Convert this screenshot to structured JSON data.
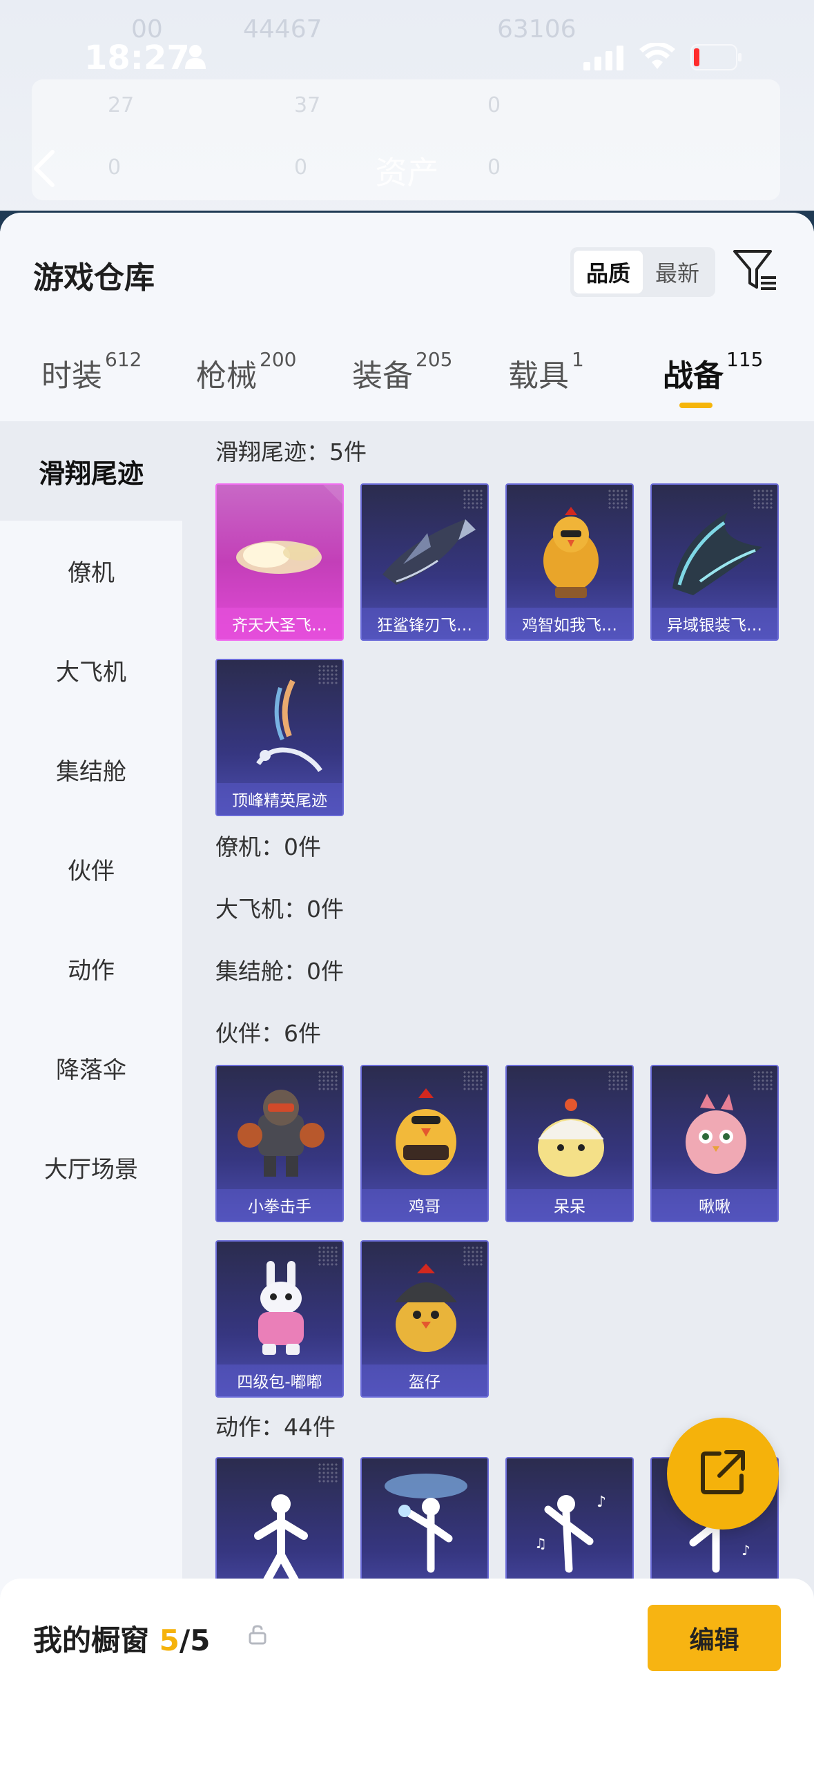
{
  "status_bar": {
    "time": "18:27"
  },
  "nav": {
    "title": "资产"
  },
  "background_header": {
    "ghost_texts": [
      "00",
      "44467",
      "63106",
      "27",
      "37",
      "0",
      "0",
      "0",
      "0"
    ]
  },
  "warehouse": {
    "title": "游戏仓库",
    "sort_options": [
      "品质",
      "最新"
    ],
    "active_sort": "品质"
  },
  "tabs": [
    {
      "label": "时装",
      "count": "612"
    },
    {
      "label": "枪械",
      "count": "200"
    },
    {
      "label": "装备",
      "count": "205"
    },
    {
      "label": "载具",
      "count": "1"
    },
    {
      "label": "战备",
      "count": "115"
    }
  ],
  "sidebar": {
    "items": [
      "滑翔尾迹",
      "僚机",
      "大飞机",
      "集结舱",
      "伙伴",
      "动作",
      "降落伞",
      "大厅场景"
    ],
    "active": "滑翔尾迹"
  },
  "sections": {
    "glide_trails": {
      "label": "滑翔尾迹：5件",
      "items": [
        "齐天大圣飞…",
        "狂鲨锋刃飞…",
        "鸡智如我飞…",
        "异域银装飞…",
        "顶峰精英尾迹"
      ]
    },
    "wingman": {
      "label": "僚机：0件"
    },
    "big_plane": {
      "label": "大飞机：0件"
    },
    "assembly_pod": {
      "label": "集结舱：0件"
    },
    "partners": {
      "label": "伙伴：6件",
      "items": [
        "小拳击手",
        "鸡哥",
        "呆呆",
        "啾啾",
        "四级包-嘟嘟",
        "盔仔"
      ]
    },
    "actions": {
      "label": "动作：44件"
    }
  },
  "showcase": {
    "title": "我的橱窗",
    "count_current": "5",
    "count_total": "/5",
    "edit_label": "编辑"
  },
  "colors": {
    "accent": "#f5b20b",
    "card_blue": "#363680",
    "card_pink": "#c33fb8"
  }
}
